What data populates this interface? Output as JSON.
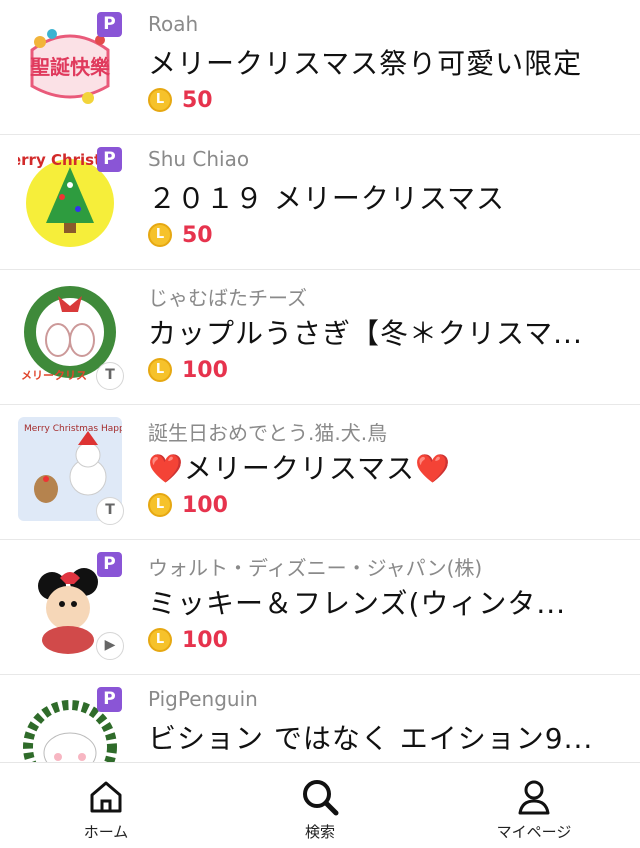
{
  "items": [
    {
      "author": "Roah",
      "title": "メリークリスマス祭り可愛い限定",
      "price": "50",
      "premium_badge": "P",
      "corner_badge": "",
      "thumb_text": "聖誕快樂"
    },
    {
      "author": "Shu Chiao",
      "title": "２０１９ メリークリスマス",
      "price": "50",
      "premium_badge": "P",
      "corner_badge": "",
      "thumb_text": "Merry Christmas"
    },
    {
      "author": "じゃむばたチーズ",
      "title": "カップルうさぎ【冬＊クリスマ...",
      "price": "100",
      "premium_badge": "",
      "corner_badge": "T",
      "thumb_text": "メリークリス"
    },
    {
      "author": "誕生日おめでとう.猫.犬.鳥",
      "title": "❤️メリークリスマス❤️",
      "price": "100",
      "premium_badge": "",
      "corner_badge": "T",
      "thumb_text": "Merry Christmas Happy New Year"
    },
    {
      "author": "ウォルト・ディズニー・ジャパン(株)",
      "title": "ミッキー＆フレンズ(ウィンタ...",
      "price": "100",
      "premium_badge": "P",
      "corner_badge": "▶",
      "thumb_text": ""
    },
    {
      "author": "PigPenguin",
      "title": "ビション ではなく エイション9...",
      "price": "",
      "premium_badge": "P",
      "corner_badge": "",
      "thumb_text": ""
    }
  ],
  "coin_symbol": "L",
  "tabs": [
    {
      "label": "ホーム",
      "icon": "home-icon"
    },
    {
      "label": "検索",
      "icon": "search-icon"
    },
    {
      "label": "マイページ",
      "icon": "person-icon"
    }
  ],
  "colors": {
    "price": "#e6334d",
    "premium": "#8a55d6",
    "coin": "#f6c22b"
  }
}
